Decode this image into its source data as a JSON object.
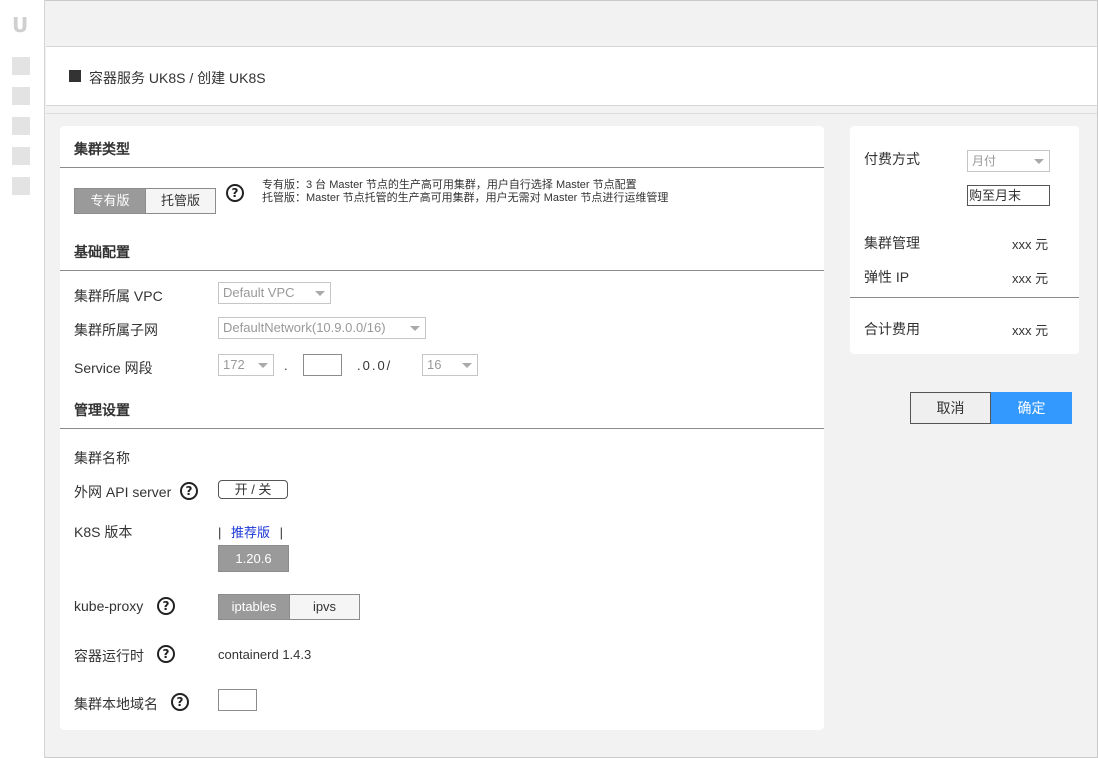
{
  "app": {
    "logo_text": "U"
  },
  "breadcrumb": {
    "text": "容器服务 UK8S / 创建 UK8S"
  },
  "sections": {
    "cluster_type": "集群类型",
    "basic_config": "基础配置",
    "manage_settings": "管理设置"
  },
  "cluster_type": {
    "options": [
      "专有版",
      "托管版"
    ],
    "selected": "专有版",
    "desc_line1": "专有版：3 台 Master 节点的生产高可用集群，用户自行选择 Master 节点配置",
    "desc_line2": "托管版：Master 节点托管的生产高可用集群，用户无需对 Master 节点进行运维管理"
  },
  "basic": {
    "vpc_label": "集群所属 VPC",
    "vpc_value": "Default VPC",
    "subnet_label": "集群所属子网",
    "subnet_value": "DefaultNetwork(10.9.0.0/16)",
    "service_label": "Service 网段",
    "service_first": "172",
    "service_dot": ".",
    "service_mid": ".0.0/",
    "service_mask": "16"
  },
  "manage": {
    "name_label": "集群名称",
    "api_label": "外网 API server",
    "api_toggle": "开 / 关",
    "k8s_label": "K8S 版本",
    "k8s_sep_left": "|",
    "k8s_recommended": "推荐版",
    "k8s_sep_right": "|",
    "k8s_version": "1.20.6",
    "proxy_label": "kube-proxy",
    "proxy_options": [
      "iptables",
      "ipvs"
    ],
    "proxy_selected": "iptables",
    "runtime_label": "容器运行时",
    "runtime_value": "containerd 1.4.3",
    "domain_label": "集群本地域名",
    "help_glyph": "?"
  },
  "billing": {
    "pay_label": "付费方式",
    "pay_select": "月付",
    "pay_duration": "购至月末",
    "mgmt_label": "集群管理",
    "mgmt_value": "xxx 元",
    "eip_label": "弹性 IP",
    "eip_value": "xxx 元",
    "total_label": "合计费用",
    "total_value": "xxx 元"
  },
  "actions": {
    "cancel": "取消",
    "confirm": "确定"
  },
  "colors": {
    "accent": "#3399ff",
    "link": "#1a35d8",
    "segment_active": "#9a9a9a"
  },
  "icons": {
    "help": "question-circle-icon",
    "dropdown": "caret-down-icon",
    "breadcrumb_marker": "square-marker-icon"
  }
}
